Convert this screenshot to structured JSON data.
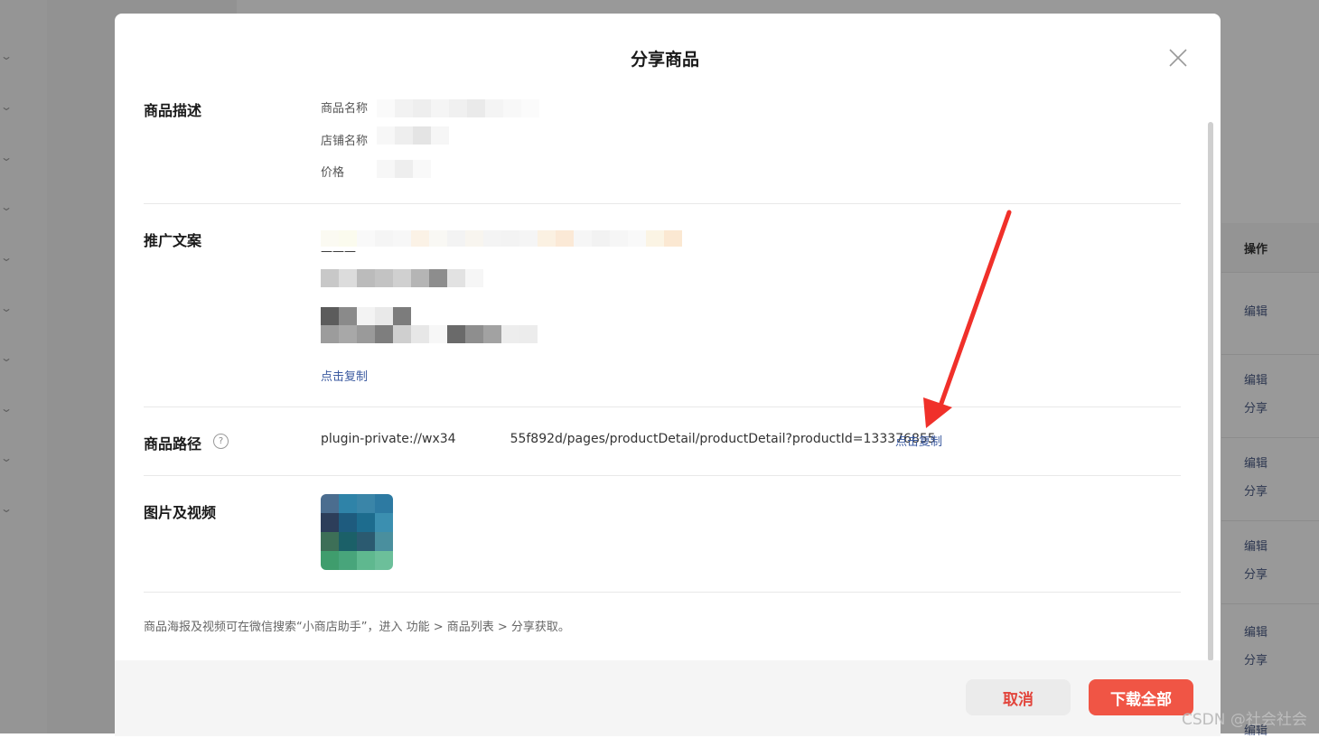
{
  "modal": {
    "title": "分享商品",
    "sections": {
      "description": {
        "title": "商品描述",
        "product_name_label": "商品名称",
        "store_name_label": "店铺名称",
        "price_label": "价格"
      },
      "promo": {
        "title": "推广文案",
        "dash_line": "———",
        "copy_label": "点击复制"
      },
      "path": {
        "title": "商品路径",
        "help_icon": "question-circle-icon",
        "prefix": "plugin-private://wx34",
        "suffix": "55f892d/pages/productDetail/productDetail?productId=133376855",
        "copy_label": "点击复制"
      },
      "media": {
        "title": "图片及视频"
      }
    },
    "note": "商品海报及视频可在微信搜索“小商店助手”，进入 功能 > 商品列表 > 分享获取。",
    "cancel_label": "取消",
    "download_label": "下载全部"
  },
  "background": {
    "column_header": "操作",
    "edit_label": "编辑",
    "share_label": "分享"
  },
  "watermark": "CSDN @社会社会",
  "colors": {
    "accent_red": "#f05545",
    "link_blue": "#3b5aa0",
    "annotation_arrow": "#f0302a"
  }
}
